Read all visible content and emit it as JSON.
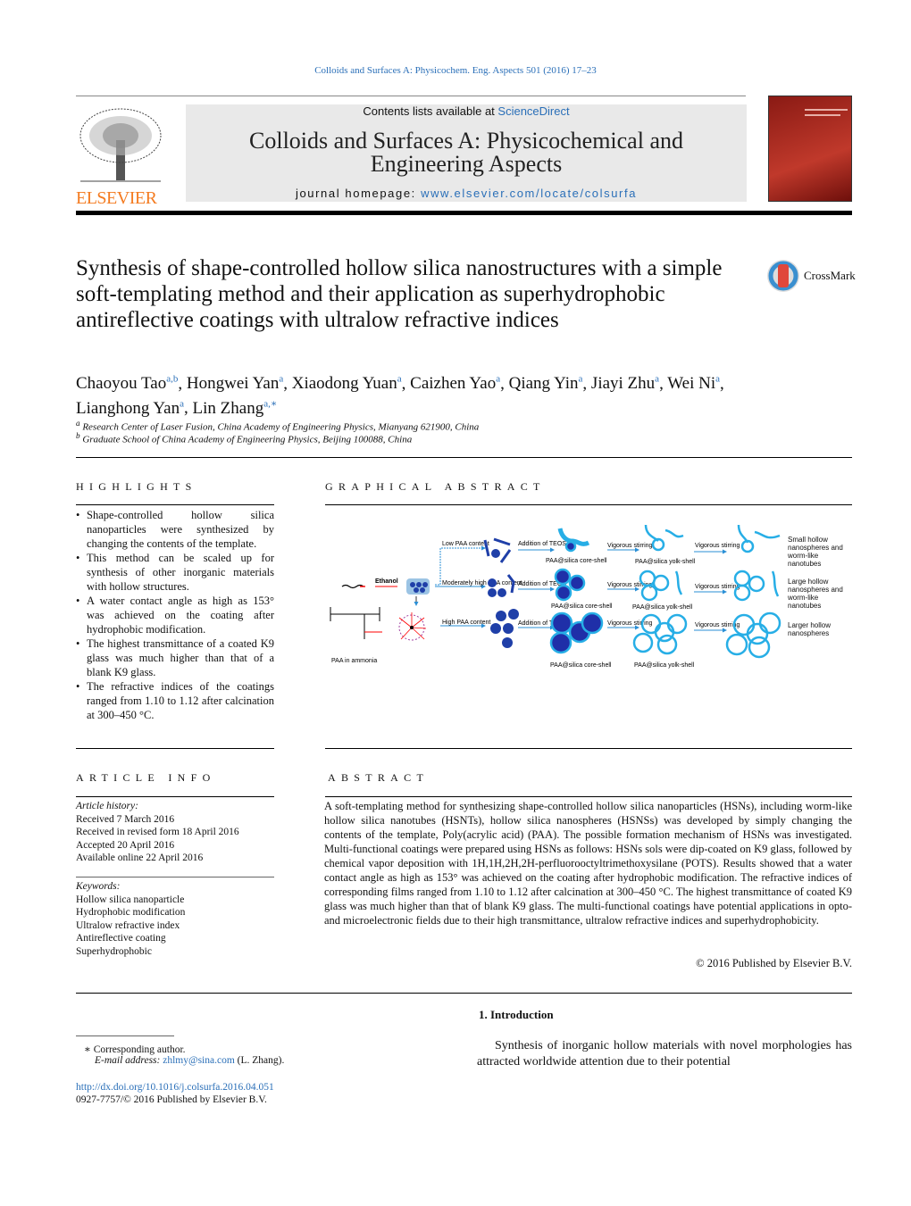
{
  "journal_ref": "Colloids and Surfaces A: Physicochem. Eng. Aspects 501 (2016) 17–23",
  "header": {
    "contents_prefix": "Contents lists available at ",
    "contents_link": "ScienceDirect",
    "journal_title_1": "Colloids and Surfaces A: Physicochemical and",
    "journal_title_2": "Engineering Aspects",
    "homepage_prefix": "journal homepage: ",
    "homepage_link": "www.elsevier.com/locate/colsurfa",
    "publisher_logo": "ELSEVIER"
  },
  "crossmark": "CrossMark",
  "title": "Synthesis of shape-controlled hollow silica nanostructures with a simple soft-templating method and their application as superhydrophobic antireflective coatings with ultralow refractive indices",
  "authors": [
    {
      "name": "Chaoyou Tao",
      "sup": "a,b"
    },
    {
      "name": "Hongwei Yan",
      "sup": "a"
    },
    {
      "name": "Xiaodong Yuan",
      "sup": "a"
    },
    {
      "name": "Caizhen Yao",
      "sup": "a"
    },
    {
      "name": "Qiang Yin",
      "sup": "a"
    },
    {
      "name": "Jiayi Zhu",
      "sup": "a"
    },
    {
      "name": "Wei Ni",
      "sup": "a"
    },
    {
      "name": "Lianghong Yan",
      "sup": "a"
    },
    {
      "name": "Lin Zhang",
      "sup": "a,∗"
    }
  ],
  "affiliations": [
    {
      "mark": "a",
      "text": "Research Center of Laser Fusion, China Academy of Engineering Physics, Mianyang 621900, China"
    },
    {
      "mark": "b",
      "text": "Graduate School of China Academy of Engineering Physics, Beijing 100088, China"
    }
  ],
  "highlights": {
    "heading": "HIGHLIGHTS",
    "items": [
      "Shape-controlled hollow silica nanoparticles were synthesized by changing the contents of the template.",
      "This method can be scaled up for synthesis of other inorganic materials with hollow structures.",
      "A water contact angle as high as 153° was achieved on the coating after hydrophobic modification.",
      "The highest transmittance of a coated K9 glass was much higher than that of a blank K9 glass.",
      "The refractive indices of the coatings ranged from 1.10 to 1.12 after calcination at 300–450 °C."
    ]
  },
  "graphical_abstract": {
    "heading": "GRAPHICAL ABSTRACT",
    "labels": {
      "ethanol": "Ethanol",
      "paa_ammonia": "PAA in ammonia",
      "low": "Low PAA content",
      "moderate": "Moderately high PAA content",
      "high": "High PAA content",
      "teos": "Addition of TEOS",
      "core_shell": "PAA@silica core-shell",
      "stirring": "Vigorous stirring",
      "yolk_shell": "PAA@silica yolk-shell",
      "result1": "Small hollow nanospheres and worm-like nanotubes",
      "result2": "Large hollow nanospheres and worm-like nanotubes",
      "result3": "Larger hollow nanospheres"
    }
  },
  "article_info": {
    "heading": "ARTICLE INFO",
    "history_label": "Article history:",
    "history": [
      "Received 7 March 2016",
      "Received in revised form 18 April 2016",
      "Accepted 20 April 2016",
      "Available online 22 April 2016"
    ],
    "keywords_label": "Keywords:",
    "keywords": [
      "Hollow silica nanoparticle",
      "Hydrophobic modification",
      "Ultralow refractive index",
      "Antireflective coating",
      "Superhydrophobic"
    ]
  },
  "abstract": {
    "heading": "ABSTRACT",
    "text": "A soft-templating method for synthesizing shape-controlled hollow silica nanoparticles (HSNs), including worm-like hollow silica nanotubes (HSNTs), hollow silica nanospheres (HSNSs) was developed by simply changing the contents of the template, Poly(acrylic acid) (PAA). The possible formation mechanism of HSNs was investigated. Multi-functional coatings were prepared using HSNs as follows: HSNs sols were dip-coated on K9 glass, followed by chemical vapor deposition with 1H,1H,2H,2H-perfluorooctyltrimethoxysilane (POTS). Results showed that a water contact angle as high as 153° was achieved on the coating after hydrophobic modification. The refractive indices of corresponding films ranged from 1.10 to 1.12 after calcination at 300–450 °C. The highest transmittance of coated K9 glass was much higher than that of blank K9 glass. The multi-functional coatings have potential applications in opto- and microelectronic fields due to their high transmittance, ultralow refractive indices and superhydrophobicity.",
    "copyright": "© 2016 Published by Elsevier B.V."
  },
  "intro": {
    "heading": "1.  Introduction",
    "text": "Synthesis of inorganic hollow materials with novel morphologies has attracted worldwide attention due to their potential"
  },
  "footnote": {
    "corresponding": "∗  Corresponding author.",
    "email_label": "E-mail address: ",
    "email": "zhlmy@sina.com",
    "email_suffix": " (L. Zhang).",
    "doi": "http://dx.doi.org/10.1016/j.colsurfa.2016.04.051",
    "issn": "0927-7757/© 2016 Published by Elsevier B.V."
  },
  "colors": {
    "link": "#2a6fb8",
    "silica": "#27aee6",
    "paa": "#1f2fa8",
    "elsevier": "#f47b20"
  }
}
